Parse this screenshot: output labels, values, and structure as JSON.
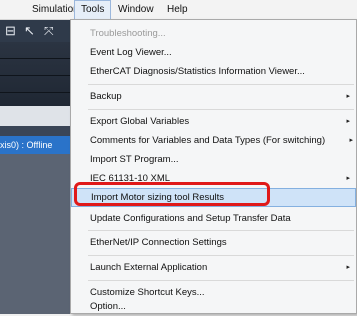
{
  "menubar": {
    "items": [
      {
        "label": "Simulation"
      },
      {
        "label": "Tools"
      },
      {
        "label": "Window"
      },
      {
        "label": "Help"
      }
    ]
  },
  "left_panel": {
    "offline_text": "xis0) : Offline"
  },
  "tools_menu": {
    "items": [
      {
        "label": "Troubleshooting...",
        "disabled": true
      },
      {
        "label": "Event Log Viewer..."
      },
      {
        "label": "EtherCAT Diagnosis/Statistics Information Viewer..."
      },
      {
        "label": "Backup",
        "submenu": true
      },
      {
        "label": "Export Global Variables",
        "submenu": true
      },
      {
        "label": "Comments for Variables and Data Types (For switching)",
        "submenu": true
      },
      {
        "label": "Import ST Program..."
      },
      {
        "label": "IEC 61131-10 XML",
        "submenu": true
      },
      {
        "label": "Import Motor sizing tool Results",
        "highlighted": true
      },
      {
        "label": "Update Configurations and Setup Transfer Data"
      },
      {
        "label": "EtherNet/IP Connection Settings"
      },
      {
        "label": "Launch External Application",
        "submenu": true
      },
      {
        "label": "Customize Shortcut Keys..."
      },
      {
        "label": "Option..."
      }
    ],
    "submenu_arrow": "▸"
  },
  "colors": {
    "highlight_bg": "#cfe3f8",
    "callout": "#e01919",
    "offline_row": "#2a73c9"
  }
}
